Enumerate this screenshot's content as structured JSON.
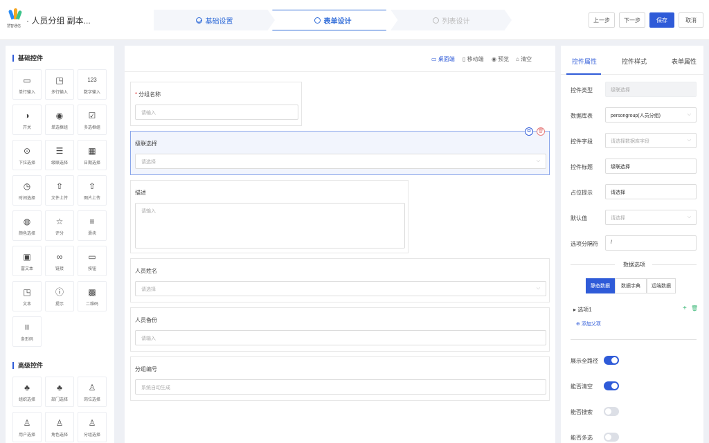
{
  "header": {
    "logo_text": "慧智通信",
    "title": "· 人员分组 副本...",
    "steps": [
      {
        "label": "基础设置",
        "state": "done"
      },
      {
        "label": "表单设计",
        "state": "active"
      },
      {
        "label": "列表设计",
        "state": "disabled"
      }
    ],
    "buttons": {
      "prev": "上一步",
      "next": "下一步",
      "save": "保存",
      "cancel": "取消"
    }
  },
  "left_panel": {
    "basic_title": "基础控件",
    "basic_widgets": [
      {
        "label": "单行输入",
        "icon": "single-line-icon",
        "glyph": "▭"
      },
      {
        "label": "多行输入",
        "icon": "multi-line-icon",
        "glyph": "◳"
      },
      {
        "label": "数字输入",
        "icon": "number-icon",
        "glyph": "123"
      },
      {
        "label": "开关",
        "icon": "switch-icon",
        "glyph": "◑"
      },
      {
        "label": "单选框组",
        "icon": "radio-icon",
        "glyph": "◉"
      },
      {
        "label": "多选框组",
        "icon": "checkbox-icon",
        "glyph": "☑"
      },
      {
        "label": "下拉选择",
        "icon": "dropdown-icon",
        "glyph": "⊙"
      },
      {
        "label": "级联选择",
        "icon": "cascade-icon",
        "glyph": "☰"
      },
      {
        "label": "日期选择",
        "icon": "calendar-icon",
        "glyph": "▦"
      },
      {
        "label": "时间选择",
        "icon": "clock-icon",
        "glyph": "◷"
      },
      {
        "label": "文件上传",
        "icon": "file-upload-icon",
        "glyph": "⇧"
      },
      {
        "label": "图片上传",
        "icon": "image-upload-icon",
        "glyph": "⇧"
      },
      {
        "label": "颜色选择",
        "icon": "palette-icon",
        "glyph": "◍"
      },
      {
        "label": "评分",
        "icon": "star-icon",
        "glyph": "☆"
      },
      {
        "label": "滑块",
        "icon": "slider-icon",
        "glyph": "≡"
      },
      {
        "label": "富文本",
        "icon": "rich-text-icon",
        "glyph": "▣"
      },
      {
        "label": "链接",
        "icon": "link-icon",
        "glyph": "∞"
      },
      {
        "label": "按钮",
        "icon": "button-icon",
        "glyph": "▭"
      },
      {
        "label": "文本",
        "icon": "text-icon",
        "glyph": "◳"
      },
      {
        "label": "提示",
        "icon": "info-icon",
        "glyph": "ⓘ"
      },
      {
        "label": "二维码",
        "icon": "qrcode-icon",
        "glyph": "▩"
      },
      {
        "label": "条形码",
        "icon": "barcode-icon",
        "glyph": "|||"
      }
    ],
    "advanced_title": "高级控件",
    "advanced_widgets": [
      {
        "label": "组织选择",
        "icon": "org-icon",
        "glyph": "♣"
      },
      {
        "label": "部门选择",
        "icon": "department-icon",
        "glyph": "♣"
      },
      {
        "label": "岗位选择",
        "icon": "position-icon",
        "glyph": "♙"
      },
      {
        "label": "用户选择",
        "icon": "user-icon",
        "glyph": "♙"
      },
      {
        "label": "角色选择",
        "icon": "role-icon",
        "glyph": "♙"
      },
      {
        "label": "分组选择",
        "icon": "group-icon",
        "glyph": "♙"
      }
    ]
  },
  "canvas": {
    "toolbar": {
      "desktop": "桌面端",
      "mobile": "移动端",
      "preview": "预览",
      "clear": "清空"
    },
    "fields": [
      {
        "label": "分组名称",
        "required": true,
        "placeholder": "请输入",
        "type": "input"
      },
      {
        "label": "级联选择",
        "required": false,
        "placeholder": "请选择",
        "type": "select"
      },
      {
        "label": "描述",
        "required": false,
        "placeholder": "请输入",
        "type": "textarea"
      },
      {
        "label": "人员姓名",
        "required": false,
        "placeholder": "请选择",
        "type": "select"
      },
      {
        "label": "人员备份",
        "required": false,
        "placeholder": "请输入",
        "type": "input"
      },
      {
        "label": "分组编号",
        "required": false,
        "placeholder": "系统自动生成",
        "type": "input"
      }
    ]
  },
  "right_panel": {
    "tabs": [
      "控件属性",
      "控件样式",
      "表单属性"
    ],
    "props": [
      {
        "label": "控件类型",
        "value": "级联选择",
        "kind": "disabled"
      },
      {
        "label": "数据库表",
        "value": "persongroup(人员分组)",
        "kind": "select"
      },
      {
        "label": "控件字段",
        "value": "请选择数据库字段",
        "kind": "select-ph"
      },
      {
        "label": "控件标题",
        "value": "级联选择",
        "kind": "input"
      },
      {
        "label": "占位提示",
        "value": "请选择",
        "kind": "input"
      },
      {
        "label": "默认值",
        "value": "请选择",
        "kind": "select-ph"
      },
      {
        "label": "选项分隔符",
        "value": "/",
        "kind": "input"
      }
    ],
    "data_options_title": "数据选项",
    "data_source_tabs": [
      "静态数据",
      "数据字典",
      "远端数据"
    ],
    "option_item": "选项1",
    "add_parent": "添加父项",
    "switches": [
      {
        "label": "展示全路径",
        "on": true
      },
      {
        "label": "能否清空",
        "on": true
      },
      {
        "label": "能否搜索",
        "on": false
      },
      {
        "label": "能否多选",
        "on": false
      }
    ]
  }
}
